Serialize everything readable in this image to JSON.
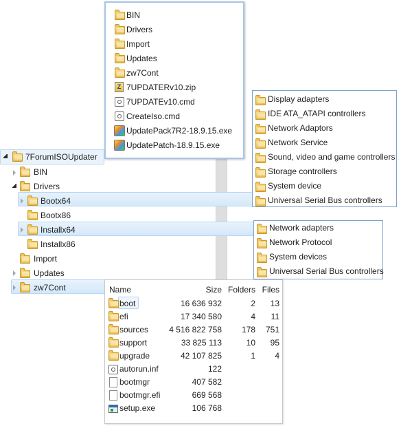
{
  "top_popup": {
    "items": [
      {
        "label": "BIN",
        "icon": "folder-icon"
      },
      {
        "label": "Drivers",
        "icon": "folder-icon"
      },
      {
        "label": "Import",
        "icon": "folder-icon"
      },
      {
        "label": "Updates",
        "icon": "folder-icon"
      },
      {
        "label": "zw7Cont",
        "icon": "folder-icon"
      },
      {
        "label": "7UPDATERv10.zip",
        "icon": "zip-icon"
      },
      {
        "label": "7UPDATEv10.cmd",
        "icon": "cmd-icon"
      },
      {
        "label": "CreateIso.cmd",
        "icon": "cmd-icon"
      },
      {
        "label": "UpdatePack7R2-18.9.15.exe",
        "icon": "installer-icon"
      },
      {
        "label": "UpdatePatch-18.9.15.exe",
        "icon": "installer-icon"
      }
    ]
  },
  "tree": {
    "root": "7ForumISOUpdater",
    "items": [
      {
        "label": "BIN"
      },
      {
        "label": "Drivers"
      },
      {
        "label": "Bootx64"
      },
      {
        "label": "Bootx86"
      },
      {
        "label": "Installx64"
      },
      {
        "label": "Installx86"
      },
      {
        "label": "Import"
      },
      {
        "label": "Updates"
      },
      {
        "label": "zw7Cont"
      }
    ]
  },
  "bootx64_popup": {
    "items": [
      "Display adapters",
      "IDE ATA_ATAPI controllers",
      "Network Adaptors",
      "Network Service",
      "Sound, video and game controllers",
      "Storage controllers",
      "System device",
      "Universal Serial Bus controllers"
    ]
  },
  "installx64_popup": {
    "items": [
      "Network adapters",
      "Network Protocol",
      "System devices",
      "Universal Serial Bus controllers"
    ]
  },
  "details": {
    "headers": {
      "name": "Name",
      "size": "Size",
      "folders": "Folders",
      "files": "Files"
    },
    "rows": [
      {
        "name": "boot",
        "size": "16 636 932",
        "folders": "2",
        "files": "13",
        "icon": "folder-icon"
      },
      {
        "name": "efi",
        "size": "17 340 580",
        "folders": "4",
        "files": "11",
        "icon": "folder-icon"
      },
      {
        "name": "sources",
        "size": "4 516 822 758",
        "folders": "178",
        "files": "751",
        "icon": "folder-icon"
      },
      {
        "name": "support",
        "size": "33 825 113",
        "folders": "10",
        "files": "95",
        "icon": "folder-icon"
      },
      {
        "name": "upgrade",
        "size": "42 107 825",
        "folders": "1",
        "files": "4",
        "icon": "folder-icon"
      },
      {
        "name": "autorun.inf",
        "size": "122",
        "folders": "",
        "files": "",
        "icon": "settings-file-icon"
      },
      {
        "name": "bootmgr",
        "size": "407 582",
        "folders": "",
        "files": "",
        "icon": "file-icon"
      },
      {
        "name": "bootmgr.efi",
        "size": "669 568",
        "folders": "",
        "files": "",
        "icon": "file-icon"
      },
      {
        "name": "setup.exe",
        "size": "106 768",
        "folders": "",
        "files": "",
        "icon": "app-icon"
      }
    ]
  },
  "colors": {
    "popup_border": "#7da2ce",
    "selection": "#d4e8fa",
    "folder": "#e8b84a"
  }
}
